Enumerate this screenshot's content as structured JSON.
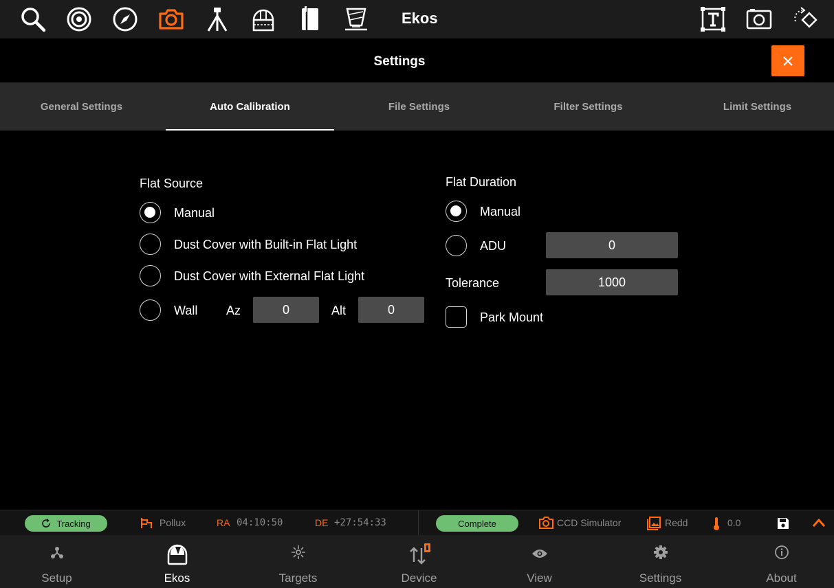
{
  "app_title": "Ekos",
  "settings_title": "Settings",
  "tabs": [
    {
      "label": "General Settings",
      "active": false
    },
    {
      "label": "Auto Calibration",
      "active": true
    },
    {
      "label": "File Settings",
      "active": false
    },
    {
      "label": "Filter Settings",
      "active": false
    },
    {
      "label": "Limit Settings",
      "active": false
    }
  ],
  "flat_source": {
    "title": "Flat Source",
    "options": [
      "Manual",
      "Dust Cover with Built-in Flat Light",
      "Dust Cover with External Flat Light",
      "Wall"
    ],
    "selected": "Manual",
    "az_label": "Az",
    "az_value": "0",
    "alt_label": "Alt",
    "alt_value": "0"
  },
  "flat_duration": {
    "title": "Flat Duration",
    "manual_label": "Manual",
    "adu_label": "ADU",
    "adu_value": "0",
    "selected": "Manual",
    "tolerance_label": "Tolerance",
    "tolerance_value": "1000",
    "park_mount_label": "Park Mount",
    "park_mount_checked": false
  },
  "status": {
    "mount_state": "Tracking",
    "target": "Pollux",
    "ra_label": "RA",
    "ra_value": "04:10:50",
    "de_label": "DE",
    "de_value": "+27:54:33",
    "capture_state": "Complete",
    "camera": "CCD Simulator",
    "filter": "Redd",
    "temperature": "0.0"
  },
  "bottom_nav": [
    {
      "label": "Setup",
      "active": false
    },
    {
      "label": "Ekos",
      "active": true
    },
    {
      "label": "Targets",
      "active": false
    },
    {
      "label": "Device",
      "active": false
    },
    {
      "label": "View",
      "active": false
    },
    {
      "label": "Settings",
      "active": false
    },
    {
      "label": "About",
      "active": false
    }
  ],
  "colors": {
    "accent": "#ff6a13",
    "status_green": "#6fbf73",
    "toolbar_bg": "#1c1c1c",
    "tab_bg": "#2a2a2a",
    "field_bg": "#4b4b4b"
  }
}
